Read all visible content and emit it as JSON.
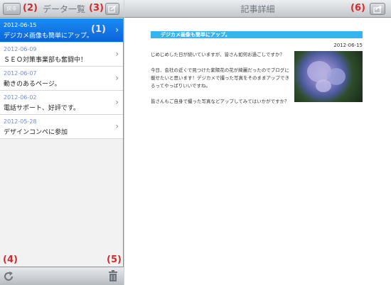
{
  "left_pane": {
    "back_label": "戻る",
    "title": "データ一覧",
    "markers": {
      "back": "(2)",
      "compose": "(3)",
      "selected": "(1)",
      "refresh": "(4)",
      "delete": "(5)"
    },
    "items": [
      {
        "date": "2012-06-15",
        "title": "デジカメ画像も簡単にアップ。",
        "selected": true
      },
      {
        "date": "2012-06-09",
        "title": "ＳＥＯ対策事業部も奮闘中！",
        "selected": false
      },
      {
        "date": "2012-06-07",
        "title": "動きのあるページ。",
        "selected": false
      },
      {
        "date": "2012-06-02",
        "title": "電話サポート、好評です。",
        "selected": false
      },
      {
        "date": "2012-05-28",
        "title": "デザインコンペに参加",
        "selected": false
      }
    ]
  },
  "right_pane": {
    "title": "記事詳細",
    "marker_share": "(6)",
    "article": {
      "heading": "デジカメ画像も簡単にアップ。",
      "date": "2012-06-15",
      "lines": [
        "じめじめした日が続いていますが、皆さん如何お過ごしですか？",
        "今日、会社の近くで見つけた紫陽花の花が綺麗だったのでブログに",
        "載せたいと思います！デジカメで撮った写真をそのままアップでき",
        "るってやっぱりいいですね。",
        "皆さんもご自身で撮った写真などアップしてみてはいかがですか？"
      ]
    }
  }
}
